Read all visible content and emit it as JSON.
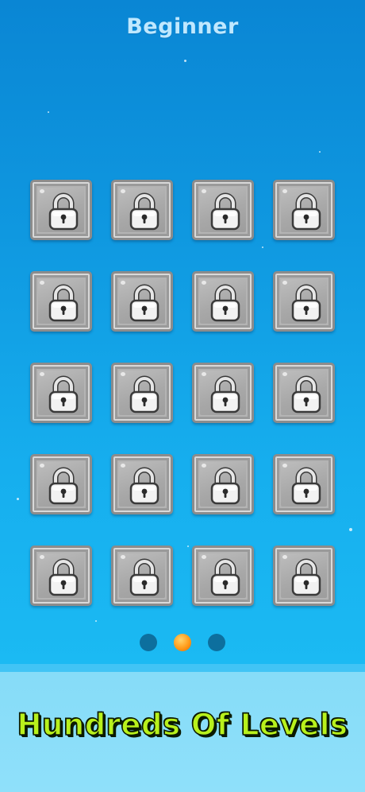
{
  "header": {
    "title": "Beginner"
  },
  "levels": {
    "rows": 5,
    "columns": 4,
    "tiles": [
      {
        "state": "locked",
        "icon": "padlock-icon"
      },
      {
        "state": "locked",
        "icon": "padlock-icon"
      },
      {
        "state": "locked",
        "icon": "padlock-icon"
      },
      {
        "state": "locked",
        "icon": "padlock-icon"
      },
      {
        "state": "locked",
        "icon": "padlock-icon"
      },
      {
        "state": "locked",
        "icon": "padlock-icon"
      },
      {
        "state": "locked",
        "icon": "padlock-icon"
      },
      {
        "state": "locked",
        "icon": "padlock-icon"
      },
      {
        "state": "locked",
        "icon": "padlock-icon"
      },
      {
        "state": "locked",
        "icon": "padlock-icon"
      },
      {
        "state": "locked",
        "icon": "padlock-icon"
      },
      {
        "state": "locked",
        "icon": "padlock-icon"
      },
      {
        "state": "locked",
        "icon": "padlock-icon"
      },
      {
        "state": "locked",
        "icon": "padlock-icon"
      },
      {
        "state": "locked",
        "icon": "padlock-icon"
      },
      {
        "state": "locked",
        "icon": "padlock-icon"
      },
      {
        "state": "locked",
        "icon": "padlock-icon"
      },
      {
        "state": "locked",
        "icon": "padlock-icon"
      },
      {
        "state": "locked",
        "icon": "padlock-icon"
      },
      {
        "state": "locked",
        "icon": "padlock-icon"
      }
    ]
  },
  "pager": {
    "pages": 3,
    "current_page": 2
  },
  "banner": {
    "text": "Hundreds Of Levels"
  },
  "colors": {
    "background_top": "#0a86d4",
    "background_bottom": "#1bbaf3",
    "tile": "#b4b4b4",
    "pager_dot": "#0d6f9e",
    "pager_dot_active": "#ff9b1a",
    "banner_text": "#b8f11c"
  }
}
